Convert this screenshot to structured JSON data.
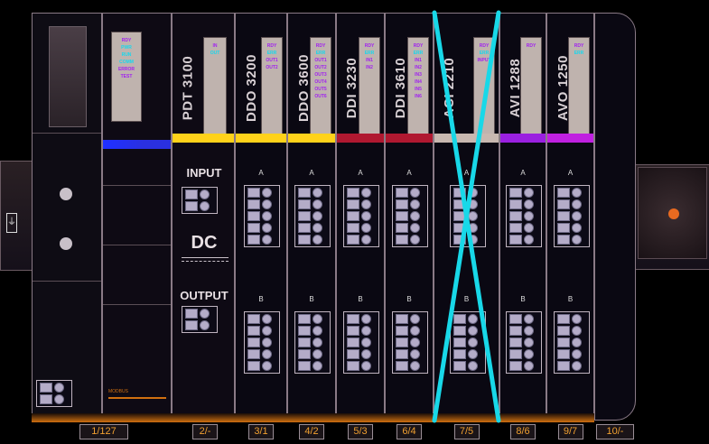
{
  "rack": {
    "power_supply": {
      "slot_label": "1/127",
      "left_connector_symbol": "⏚"
    },
    "cpu": {
      "slot_label": "",
      "leds": [
        "RDY",
        "PWR",
        "RUN",
        "COMM",
        "ERROR",
        "TEST"
      ],
      "footer_text": "MODBUS"
    },
    "pdt": {
      "name": "PDT 3100",
      "slot_label": "2/-",
      "leds": [
        "IN",
        "OUT"
      ],
      "input_label": "INPUT",
      "dc_label": "DC",
      "output_label": "OUTPUT",
      "strip_color": "#ffd21a"
    },
    "modules": [
      {
        "name": "DDO 3200",
        "slot_label": "3/1",
        "leds": [
          "RDY",
          "ERR",
          "OUT1",
          "OUT2"
        ],
        "strip_color": "#ffd21a",
        "excluded": false
      },
      {
        "name": "DDO 3600",
        "slot_label": "4/2",
        "leds": [
          "RDY",
          "ERR",
          "OUT1",
          "OUT2",
          "OUT3",
          "OUT4",
          "OUT5",
          "OUT6"
        ],
        "strip_color": "#ffd21a",
        "excluded": false
      },
      {
        "name": "DDI 3230",
        "slot_label": "5/3",
        "leds": [
          "RDY",
          "ERR",
          "IN1",
          "IN2"
        ],
        "strip_color": "#b01830",
        "excluded": false
      },
      {
        "name": "DDI 3610",
        "slot_label": "6/4",
        "leds": [
          "RDY",
          "ERR",
          "IN1",
          "IN2",
          "IN3",
          "IN4",
          "IN5",
          "IN6"
        ],
        "strip_color": "#b01830",
        "excluded": false
      },
      {
        "name": "ACI 2210",
        "slot_label": "7/5",
        "leds": [
          "RDY",
          "ERR",
          "INPUT"
        ],
        "strip_color": "#c8b8b0",
        "excluded": true
      },
      {
        "name": "AVI 1288",
        "slot_label": "8/6",
        "leds": [
          "RDY"
        ],
        "strip_color": "#9a20e0",
        "excluded": false
      },
      {
        "name": "AVO 1250",
        "slot_label": "9/7",
        "leds": [
          "RDY",
          "ERR"
        ],
        "strip_color": "#c020e0",
        "excluded": false
      }
    ],
    "terminator": {
      "slot_label": "10/-"
    },
    "block_a_label": "A",
    "block_b_label": "B",
    "colors": {
      "background": "#000000",
      "slot_label_text": "#f0a030",
      "exclusion_cross": "#18d8e8",
      "led_active": "#a020f0",
      "led_ok": "#15d8ee",
      "end_plate_led": "#e86a20"
    }
  }
}
